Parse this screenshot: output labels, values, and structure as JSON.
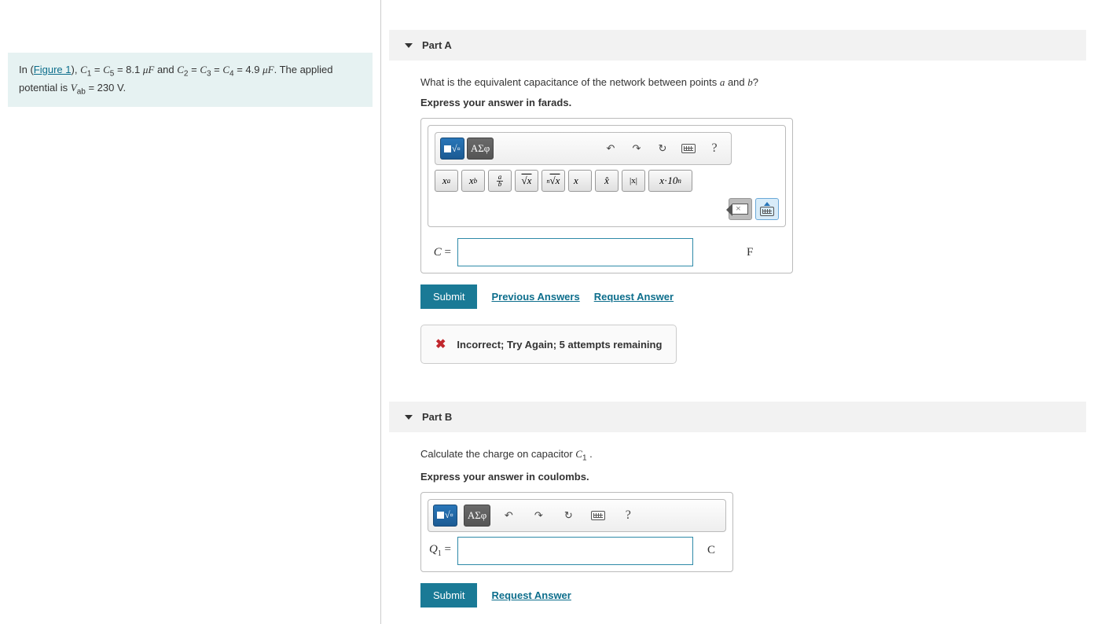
{
  "problem": {
    "prefix": "In (",
    "figure_link": "Figure 1",
    "text1": "), ",
    "eq1_lhs": "C",
    "eq1_sub1": "1",
    "eq1_mid": " = ",
    "eq1_lhs2": "C",
    "eq1_sub2": "5",
    "eq1_val": " = 8.1 ",
    "eq1_unit": "μF",
    "and": " and ",
    "eq2_c2": "C",
    "eq2_s2": "2",
    "eq2_c3": "C",
    "eq2_s3": "3",
    "eq2_c4": "C",
    "eq2_s4": "4",
    "eq2_val": " = 4.9 ",
    "eq2_unit": "μF",
    "text2": ". The applied potential is ",
    "vab": "V",
    "vab_sub": "ab",
    "vab_val": " = 230 ",
    "vab_unit": "V",
    "period": "."
  },
  "partA": {
    "title": "Part A",
    "question_pre": "What is the equivalent capacitance of the network between points ",
    "var_a": "a",
    "question_mid": " and ",
    "var_b": "b",
    "question_post": "?",
    "instruction": "Express your answer in farads.",
    "answer_var": "C",
    "answer_eq": " = ",
    "answer_unit": "F",
    "submit": "Submit",
    "prev_answers": "Previous Answers",
    "request_answer": "Request Answer",
    "feedback": "Incorrect; Try Again; 5 attempts remaining"
  },
  "partB": {
    "title": "Part B",
    "question_pre": "Calculate the charge on capacitor ",
    "var_c": "C",
    "var_sub": "1",
    "question_post": " .",
    "instruction": "Express your answer in coulombs.",
    "answer_var": "Q",
    "answer_sub": "1",
    "answer_eq": " = ",
    "answer_unit": "C",
    "submit": "Submit",
    "request_answer": "Request Answer"
  },
  "toolbar": {
    "greek": "ΑΣφ",
    "xa": "x",
    "xa_sup": "a",
    "xb": "x",
    "xb_sub": "b",
    "frac_a": "a",
    "frac_b": "b",
    "sqrt": "√x",
    "nroot_n": "n",
    "nroot": "√x",
    "vec": "x⃗",
    "hat": "x̂",
    "abs": "|x|",
    "sci_x": "x",
    "sci_dot": "·",
    "sci_10": "10",
    "sci_n": "n",
    "help": "?",
    "undo": "↶",
    "redo": "↷",
    "reset": "↻"
  }
}
